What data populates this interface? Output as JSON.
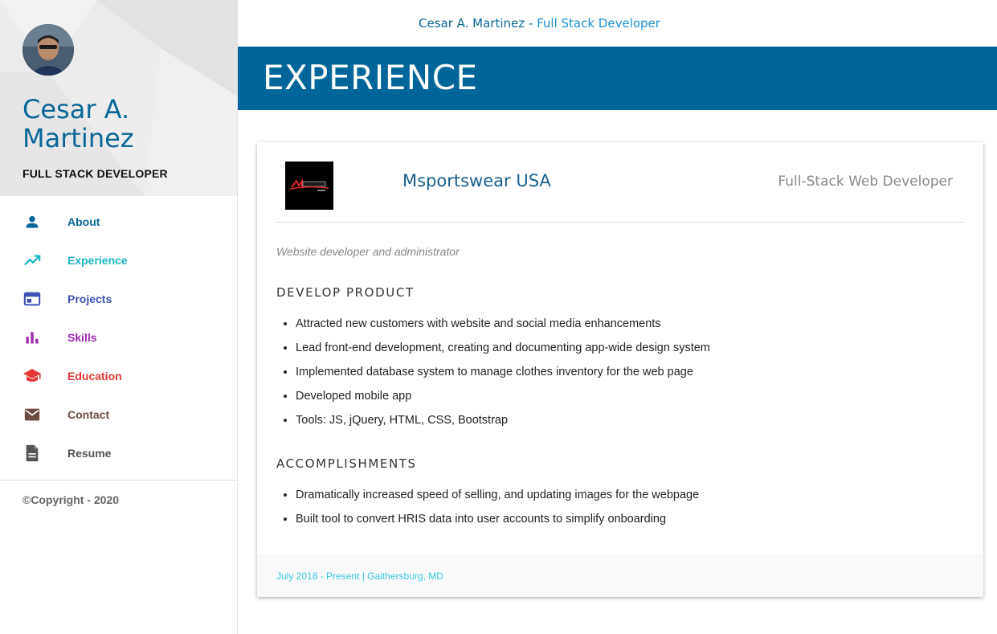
{
  "profile": {
    "name": "Cesar A. Martinez",
    "role": "FULL STACK DEVELOPER"
  },
  "nav": [
    {
      "label": "About",
      "icon": "person-icon",
      "color": "#0a6696"
    },
    {
      "label": "Experience",
      "icon": "trending-up-icon",
      "color": "#17b5c7"
    },
    {
      "label": "Projects",
      "icon": "browser-window-icon",
      "color": "#3f51b5"
    },
    {
      "label": "Skills",
      "icon": "bar-chart-icon",
      "color": "#9c27b0"
    },
    {
      "label": "Education",
      "icon": "graduation-cap-icon",
      "color": "#e53935"
    },
    {
      "label": "Contact",
      "icon": "mail-icon",
      "color": "#6d4c41"
    },
    {
      "label": "Resume",
      "icon": "document-icon",
      "color": "#555555"
    }
  ],
  "copyright": "©Copyright - 2020",
  "header": {
    "name": "Cesar A. Martinez",
    "separator": " - ",
    "subtitle": "Full Stack Developer"
  },
  "banner": {
    "title": "EXPERIENCE"
  },
  "job": {
    "company": "Msportswear USA",
    "title": "Full-Stack Web Developer",
    "summary": "Website developer and administrator",
    "sections": [
      {
        "heading": "DEVELOP PRODUCT",
        "items": [
          "Attracted new customers with website and social media enhancements",
          "Lead front-end development, creating and documenting app-wide design system",
          "Implemented database system to manage clothes inventory for the web page",
          "Developed mobile app",
          "Tools: JS, jQuery, HTML, CSS, Bootstrap"
        ]
      },
      {
        "heading": "ACCOMPLISHMENTS",
        "items": [
          "Dramatically increased speed of selling, and updating images for the webpage",
          "Built tool to convert HRIS data into user accounts to simplify onboarding"
        ]
      }
    ],
    "footer": "July 2018 - Present | Gaithersburg, MD"
  },
  "colors": {
    "brand": "#006699",
    "accent": "#1a8fcf"
  }
}
